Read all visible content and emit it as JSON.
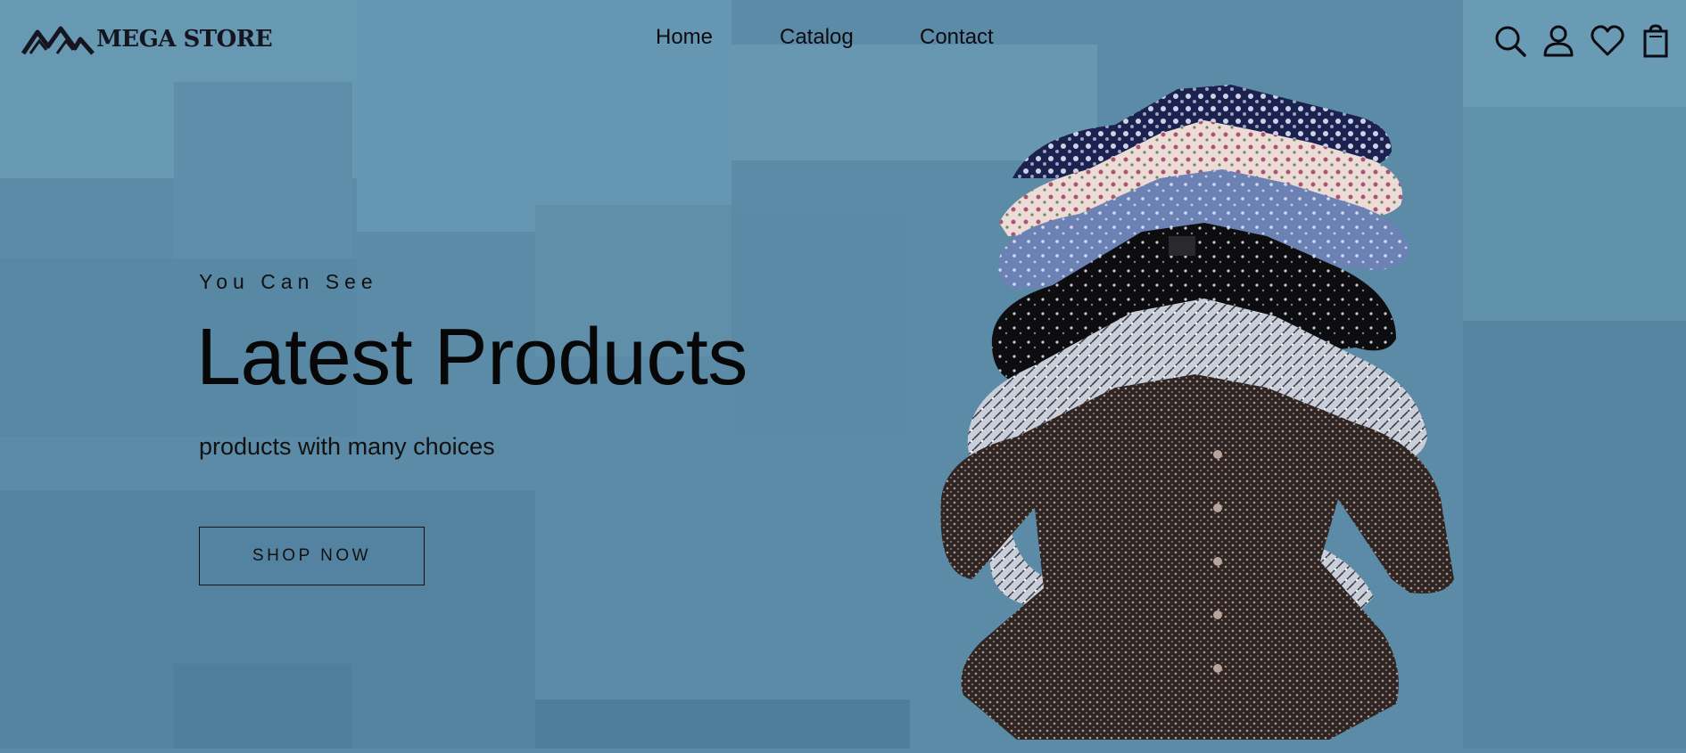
{
  "brand": {
    "name": "MEGA STORE",
    "logo": "mountains-logo-icon"
  },
  "nav": {
    "items": [
      {
        "label": "Home"
      },
      {
        "label": "Catalog"
      },
      {
        "label": "Contact"
      }
    ]
  },
  "header_icons": [
    "search-icon",
    "user-icon",
    "heart-icon",
    "shopping-bag-icon"
  ],
  "hero": {
    "eyebrow": "You Can See",
    "headline": "Latest Products",
    "subline": "products with many choices",
    "cta_label": "SHOP NOW",
    "image": "stack-of-floral-blouses"
  },
  "colors": {
    "background": "#5b8ba6",
    "text": "#0a0a0a"
  }
}
